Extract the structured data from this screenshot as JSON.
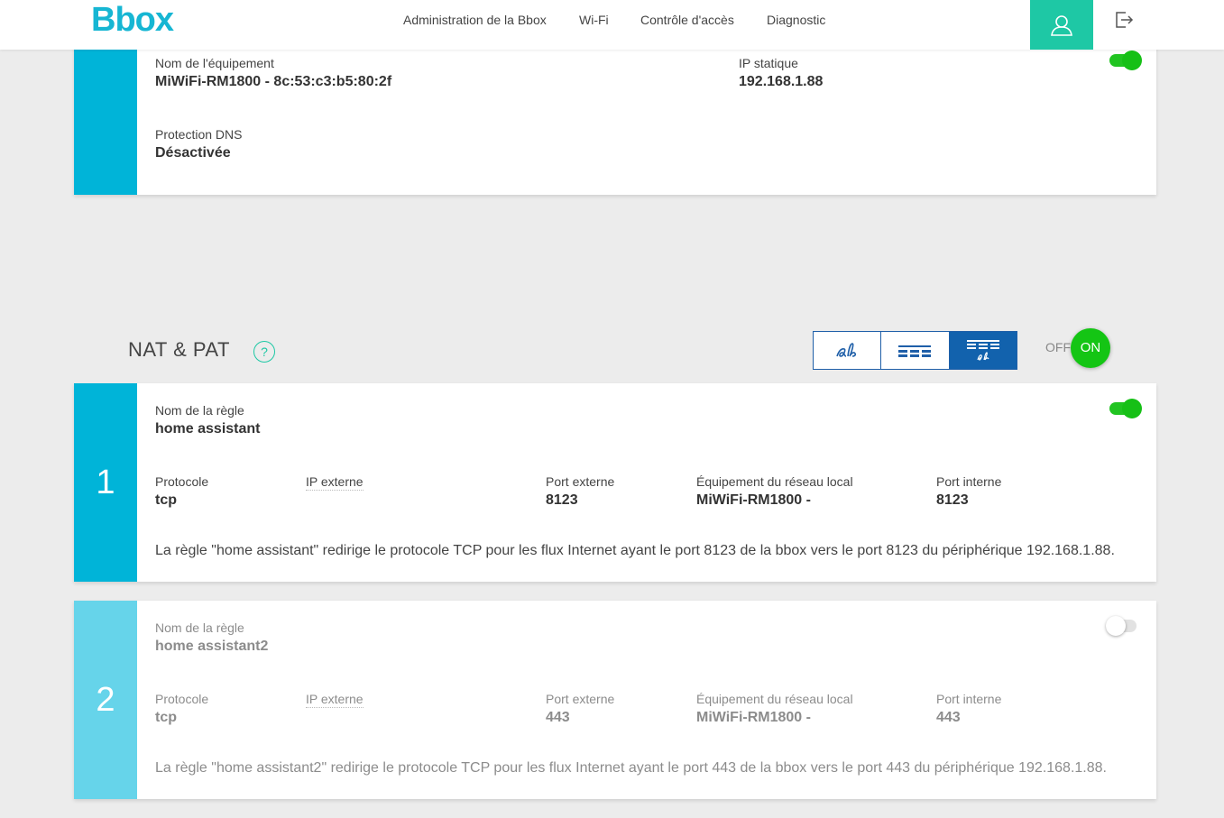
{
  "header": {
    "logo": "Bbox",
    "nav": [
      "Administration de la Bbox",
      "Wi-Fi",
      "Contrôle d'accès",
      "Diagnostic"
    ],
    "icons": {
      "user": "user-icon",
      "logout": "logout-icon"
    },
    "accent_color": "#1ec8a5"
  },
  "device_card": {
    "device_name_label": "Nom de l'équipement",
    "device_name": "MiWiFi-RM1800 - 8c:53:c3:b5:80:2f",
    "ip_label": "IP statique",
    "ip": "192.168.1.88",
    "dns_label": "Protection DNS",
    "dns_value": "Désactivée",
    "enabled": true
  },
  "nat": {
    "title": "NAT & PAT",
    "help": "?",
    "views": [
      "view-compact-icon",
      "view-list-icon",
      "view-detailed-icon"
    ],
    "toggle_off": "OFF",
    "toggle_on": "ON",
    "rules": [
      {
        "index": "1",
        "name_label": "Nom de la règle",
        "name": "home assistant",
        "protocol_label": "Protocole",
        "protocol": "tcp",
        "ext_ip_label": "IP externe",
        "ext_port_label": "Port externe",
        "ext_port": "8123",
        "device_label": "Équipement du réseau local",
        "device": "MiWiFi-RM1800 -",
        "int_port_label": "Port interne",
        "int_port": "8123",
        "description": "La règle \"home assistant\" redirige le protocole TCP pour les flux Internet ayant le port 8123 de la bbox vers le port 8123 du périphérique 192.168.1.88.",
        "enabled": true
      },
      {
        "index": "2",
        "name_label": "Nom de la règle",
        "name": "home assistant2",
        "protocol_label": "Protocole",
        "protocol": "tcp",
        "ext_ip_label": "IP externe",
        "ext_port_label": "Port externe",
        "ext_port": "443",
        "device_label": "Équipement du réseau local",
        "device": "MiWiFi-RM1800 -",
        "int_port_label": "Port interne",
        "int_port": "443",
        "description": "La règle \"home assistant2\" redirige le protocole TCP pour les flux Internet ayant le port 443 de la bbox vers le port 443 du périphérique 192.168.1.88.",
        "enabled": false
      }
    ]
  }
}
